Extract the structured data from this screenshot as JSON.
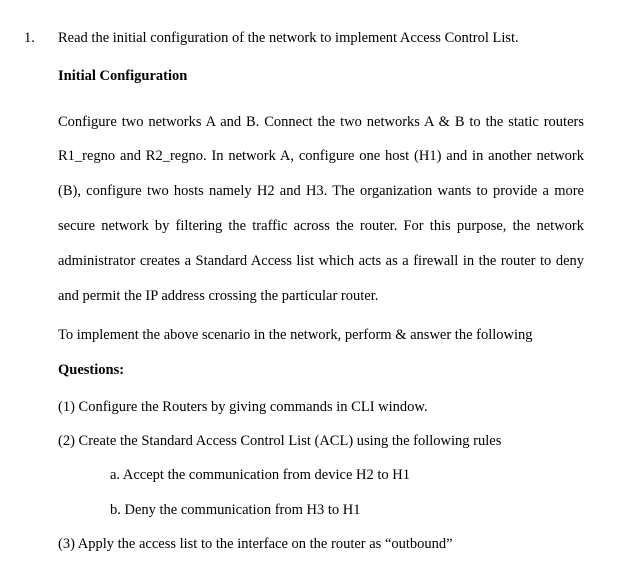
{
  "list_number": "1.",
  "intro": "Read the initial configuration of the network to implement Access Control List.",
  "heading_initial_config": "Initial Configuration",
  "body1": "Configure two networks A and B. Connect the two networks A & B to the static routers R1_regno and R2_regno. In network A, configure one host (H1) and in another network (B), configure two hosts namely H2 and H3. The organization wants to provide a more secure network by filtering the traffic across the router. For this purpose, the network administrator creates a Standard Access list which acts as a firewall in the router to deny and permit the IP address crossing the particular router.",
  "body2": "To implement the above scenario in the network, perform & answer the following",
  "heading_questions": "Questions:",
  "questions": {
    "q1": "(1) Configure the Routers by giving commands in CLI window.",
    "q2": "(2) Create the Standard Access Control List (ACL) using the following rules",
    "q2a": "a. Accept the communication from device H2 to H1",
    "q2b": "b. Deny the communication from H3 to H1",
    "q3": "(3) Apply the access list to the interface on the router as “outbound”"
  }
}
